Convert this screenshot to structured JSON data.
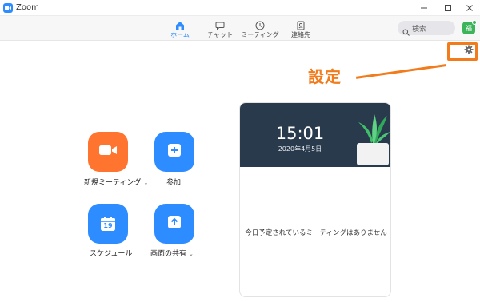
{
  "window": {
    "title": "Zoom"
  },
  "nav": {
    "home": "ホーム",
    "chat": "チャット",
    "meetings": "ミーティング",
    "contacts": "連絡先"
  },
  "search": {
    "label": "検索"
  },
  "user": {
    "avatar_initial": "福"
  },
  "annotation": {
    "settings_label": "設定",
    "color": "#f27b1b"
  },
  "actions": {
    "new_meeting": "新規ミーティング",
    "join": "参加",
    "schedule": "スケジュール",
    "calendar_day": "19",
    "share_screen": "画面の共有"
  },
  "meeting_card": {
    "time": "15:01",
    "date": "2020年4月5日",
    "empty_message": "今日予定されているミーティングはありません"
  },
  "colors": {
    "accent_blue": "#2d8cff",
    "accent_orange": "#ff742e",
    "header_dark": "#2a3a4d"
  }
}
